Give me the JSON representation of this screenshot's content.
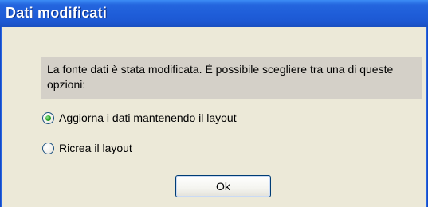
{
  "dialog": {
    "title": "Dati modificati",
    "message": "La fonte dati è stata modificata. È possibile scegliere tra una di queste opzioni:",
    "options": [
      {
        "label": "Aggiorna i dati mantenendo il layout",
        "checked": true
      },
      {
        "label": "Ricrea il layout",
        "checked": false
      }
    ],
    "ok_label": "Ok"
  }
}
